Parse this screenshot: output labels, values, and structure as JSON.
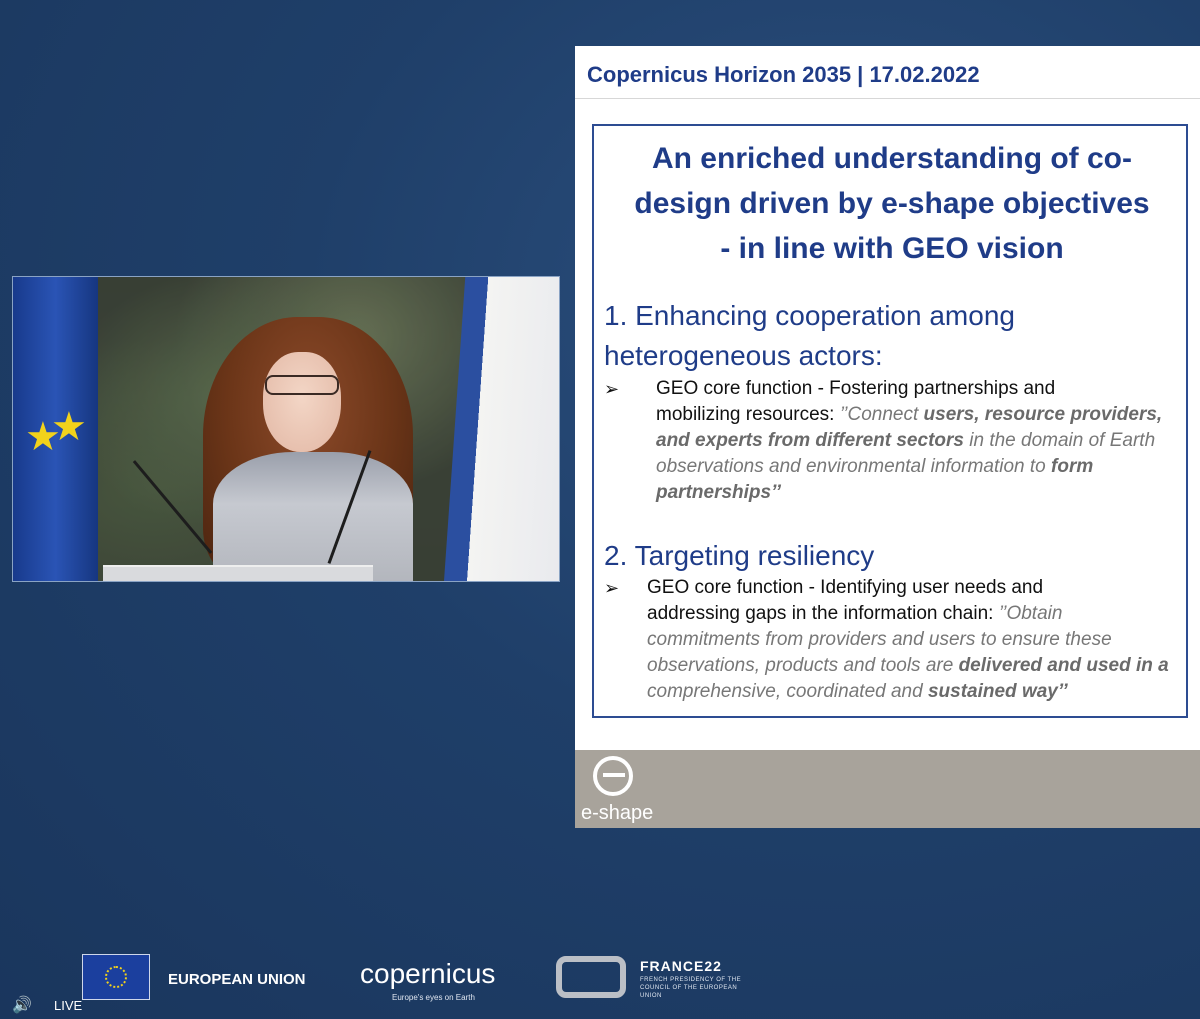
{
  "slide": {
    "header": "Copernicus Horizon 2035 | 17.02.2022",
    "title": [
      "An enriched understanding of co-",
      "design driven by e-shape objectives",
      "- in line with GEO vision"
    ],
    "section1": {
      "heading_line1": "1. Enhancing cooperation among",
      "heading_line2": "heterogeneous actors:",
      "bullet_line1": "GEO core function - Fostering partnerships and",
      "bullet_line2_plain": "mobilizing resources: ",
      "bullet_line2_quote": "’’Connect ",
      "bullet_line2_bold": "users, resource providers,",
      "bullet_line3_bold": "and experts from different sectors",
      "bullet_line3_quote": " in the domain of Earth",
      "bullet_line4_quote": "observations and environmental information to ",
      "bullet_line4_bold": "form",
      "bullet_line5_bold": "partnerships’’"
    },
    "section2": {
      "heading": "2. Targeting resiliency",
      "bullet_line1": "GEO core function - Identifying user needs and",
      "bullet_line2_plain": "addressing gaps in the information chain: ",
      "bullet_line2_quote": "’’Obtain",
      "bullet_line3_quote": "commitments from providers and users to ensure these",
      "bullet_line4_quote": "observations, products and tools are ",
      "bullet_line4_bold": "delivered and used in a",
      "bullet_line5_quote": "comprehensive, coordinated and ",
      "bullet_line5_bold": "sustained way’’"
    },
    "footer_logo_text": "e-shape"
  },
  "bottom_bar": {
    "eu_label": "EUROPEAN UNION",
    "copernicus": "copernicus",
    "copernicus_tagline": "Europe's eyes on Earth",
    "france_title": "FRANCE22",
    "france_sub": "FRENCH PRESIDENCY OF THE COUNCIL OF THE EUROPEAN UNION",
    "live_label": "LIVE"
  },
  "icons": [
    "volume-icon",
    "eu-flag-icon",
    "eshape-logo-icon",
    "france22-logo-icon"
  ],
  "colors": {
    "background": "#1f3f69",
    "slide_blue": "#1f3c88",
    "footer_grey": "#a8a39b"
  }
}
